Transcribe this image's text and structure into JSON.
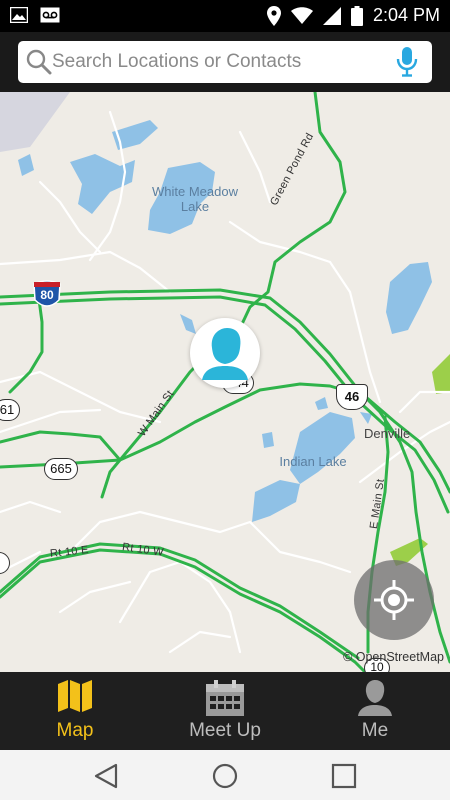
{
  "status_bar": {
    "time": "2:04 PM",
    "icons": [
      "image-icon",
      "voicemail-icon",
      "location-pin-icon",
      "wifi-icon",
      "cell-signal-icon",
      "battery-icon"
    ]
  },
  "search": {
    "placeholder": "Search Locations or Contacts",
    "value": ""
  },
  "map": {
    "water_labels": [
      "White Meadow Lake",
      "Indian Lake"
    ],
    "town_label": "Denville",
    "road_labels": [
      "Green Pond Rd",
      "W Main St",
      "E Main St",
      "Rt 10 E",
      "Rt 10 W"
    ],
    "shields": [
      {
        "id": "interstate",
        "text": "80"
      },
      {
        "id": "us",
        "text": "46"
      },
      {
        "id": "route-665",
        "text": "665"
      },
      {
        "id": "route-61",
        "text": "61"
      },
      {
        "id": "route-644",
        "text": "644"
      },
      {
        "id": "route-10",
        "text": "10"
      }
    ],
    "attribution": "© OpenStreetMap",
    "colors": {
      "land": "#efece6",
      "water": "#8fc1e6",
      "road": "#2fb34a",
      "park": "#9ccf4a"
    }
  },
  "tabs": [
    {
      "label": "Map",
      "icon": "map-icon",
      "active": true
    },
    {
      "label": "Meet Up",
      "icon": "calendar-icon",
      "active": false
    },
    {
      "label": "Me",
      "icon": "person-icon",
      "active": false
    }
  ],
  "accent_color": "#f3c11a",
  "system_nav": [
    "back-icon",
    "home-icon",
    "recents-icon"
  ]
}
